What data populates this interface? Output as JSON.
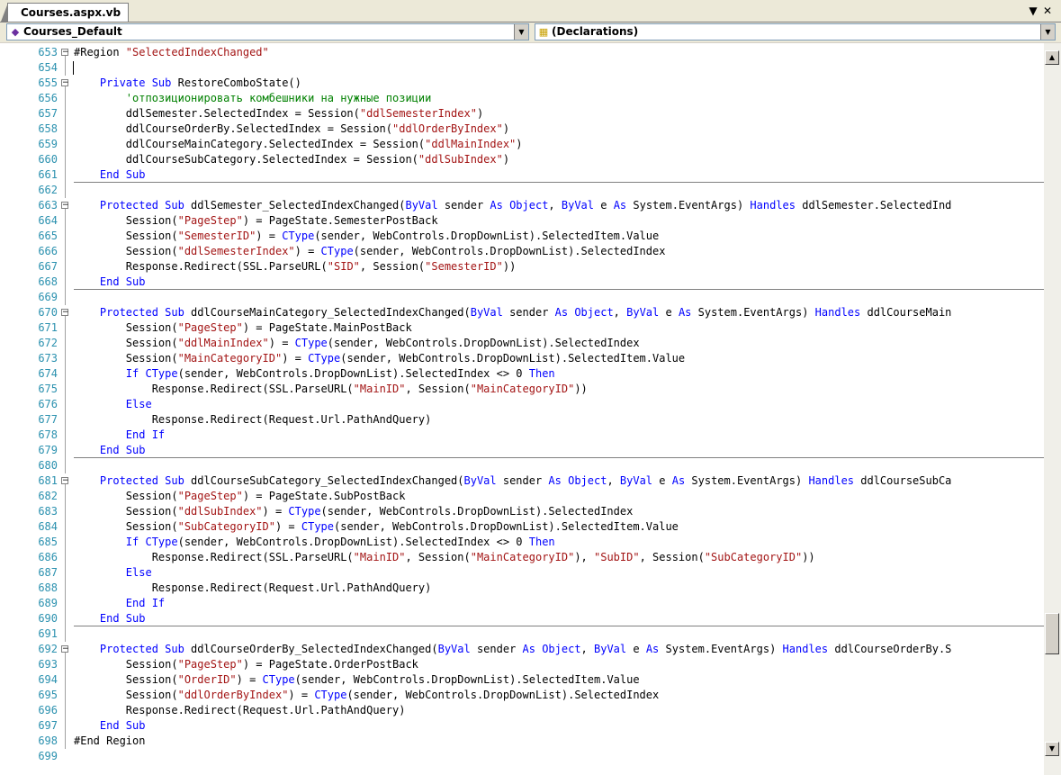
{
  "tab": {
    "title": "Courses.aspx.vb",
    "controls": {
      "dropdown": "▼",
      "close": "✕"
    }
  },
  "nav": {
    "class_combo": {
      "icon": "vb-class-icon",
      "value": "Courses_Default"
    },
    "member_combo": {
      "icon": "declarations-icon",
      "value": "(Declarations)"
    }
  },
  "code_lines": [
    {
      "n": "653",
      "fold": "box",
      "sep": false,
      "t": [
        [
          "",
          "#Region "
        ],
        [
          "str",
          "\"SelectedIndexChanged\""
        ]
      ]
    },
    {
      "n": "654",
      "fold": "line",
      "sep": false,
      "t": []
    },
    {
      "n": "655",
      "fold": "box",
      "sep": false,
      "t": [
        [
          "",
          "    "
        ],
        [
          "kw",
          "Private Sub"
        ],
        [
          "",
          " RestoreComboState()"
        ]
      ]
    },
    {
      "n": "656",
      "fold": "line",
      "sep": false,
      "t": [
        [
          "",
          "        "
        ],
        [
          "cm",
          "'отпозиционировать комбешники на нужные позиции"
        ]
      ]
    },
    {
      "n": "657",
      "fold": "line",
      "sep": false,
      "t": [
        [
          "",
          "        ddlSemester.SelectedIndex = Session("
        ],
        [
          "str",
          "\"ddlSemesterIndex\""
        ],
        [
          "",
          ")"
        ]
      ]
    },
    {
      "n": "658",
      "fold": "line",
      "sep": false,
      "t": [
        [
          "",
          "        ddlCourseOrderBy.SelectedIndex = Session("
        ],
        [
          "str",
          "\"ddlOrderByIndex\""
        ],
        [
          "",
          ")"
        ]
      ]
    },
    {
      "n": "659",
      "fold": "line",
      "sep": false,
      "t": [
        [
          "",
          "        ddlCourseMainCategory.SelectedIndex = Session("
        ],
        [
          "str",
          "\"ddlMainIndex\""
        ],
        [
          "",
          ")"
        ]
      ]
    },
    {
      "n": "660",
      "fold": "line",
      "sep": false,
      "t": [
        [
          "",
          "        ddlCourseSubCategory.SelectedIndex = Session("
        ],
        [
          "str",
          "\"ddlSubIndex\""
        ],
        [
          "",
          ")"
        ]
      ]
    },
    {
      "n": "661",
      "fold": "line",
      "sep": true,
      "t": [
        [
          "",
          "    "
        ],
        [
          "kw",
          "End Sub"
        ]
      ]
    },
    {
      "n": "662",
      "fold": "line",
      "sep": false,
      "t": []
    },
    {
      "n": "663",
      "fold": "box",
      "sep": false,
      "t": [
        [
          "",
          "    "
        ],
        [
          "kw",
          "Protected Sub"
        ],
        [
          "",
          " ddlSemester_SelectedIndexChanged("
        ],
        [
          "kw",
          "ByVal"
        ],
        [
          "",
          " sender "
        ],
        [
          "kw",
          "As Object"
        ],
        [
          "",
          ", "
        ],
        [
          "kw",
          "ByVal"
        ],
        [
          "",
          " e "
        ],
        [
          "kw",
          "As"
        ],
        [
          "",
          " System.EventArgs) "
        ],
        [
          "kw",
          "Handles"
        ],
        [
          "",
          " ddlSemester.SelectedInd"
        ]
      ]
    },
    {
      "n": "664",
      "fold": "line",
      "sep": false,
      "t": [
        [
          "",
          "        Session("
        ],
        [
          "str",
          "\"PageStep\""
        ],
        [
          "",
          ") = PageState.SemesterPostBack"
        ]
      ]
    },
    {
      "n": "665",
      "fold": "line",
      "sep": false,
      "t": [
        [
          "",
          "        Session("
        ],
        [
          "str",
          "\"SemesterID\""
        ],
        [
          "",
          ") = "
        ],
        [
          "kw",
          "CType"
        ],
        [
          "",
          "(sender, WebControls.DropDownList).SelectedItem.Value"
        ]
      ]
    },
    {
      "n": "666",
      "fold": "line",
      "sep": false,
      "t": [
        [
          "",
          "        Session("
        ],
        [
          "str",
          "\"ddlSemesterIndex\""
        ],
        [
          "",
          ") = "
        ],
        [
          "kw",
          "CType"
        ],
        [
          "",
          "(sender, WebControls.DropDownList).SelectedIndex"
        ]
      ]
    },
    {
      "n": "667",
      "fold": "line",
      "sep": false,
      "t": [
        [
          "",
          "        Response.Redirect(SSL.ParseURL("
        ],
        [
          "str",
          "\"SID\""
        ],
        [
          "",
          ", Session("
        ],
        [
          "str",
          "\"SemesterID\""
        ],
        [
          "",
          "))"
        ]
      ]
    },
    {
      "n": "668",
      "fold": "line",
      "sep": true,
      "t": [
        [
          "",
          "    "
        ],
        [
          "kw",
          "End Sub"
        ]
      ]
    },
    {
      "n": "669",
      "fold": "line",
      "sep": false,
      "t": []
    },
    {
      "n": "670",
      "fold": "box",
      "sep": false,
      "t": [
        [
          "",
          "    "
        ],
        [
          "kw",
          "Protected Sub"
        ],
        [
          "",
          " ddlCourseMainCategory_SelectedIndexChanged("
        ],
        [
          "kw",
          "ByVal"
        ],
        [
          "",
          " sender "
        ],
        [
          "kw",
          "As Object"
        ],
        [
          "",
          ", "
        ],
        [
          "kw",
          "ByVal"
        ],
        [
          "",
          " e "
        ],
        [
          "kw",
          "As"
        ],
        [
          "",
          " System.EventArgs) "
        ],
        [
          "kw",
          "Handles"
        ],
        [
          "",
          " ddlCourseMain"
        ]
      ]
    },
    {
      "n": "671",
      "fold": "line",
      "sep": false,
      "t": [
        [
          "",
          "        Session("
        ],
        [
          "str",
          "\"PageStep\""
        ],
        [
          "",
          ") = PageState.MainPostBack"
        ]
      ]
    },
    {
      "n": "672",
      "fold": "line",
      "sep": false,
      "t": [
        [
          "",
          "        Session("
        ],
        [
          "str",
          "\"ddlMainIndex\""
        ],
        [
          "",
          ") = "
        ],
        [
          "kw",
          "CType"
        ],
        [
          "",
          "(sender, WebControls.DropDownList).SelectedIndex"
        ]
      ]
    },
    {
      "n": "673",
      "fold": "line",
      "sep": false,
      "t": [
        [
          "",
          "        Session("
        ],
        [
          "str",
          "\"MainCategoryID\""
        ],
        [
          "",
          ") = "
        ],
        [
          "kw",
          "CType"
        ],
        [
          "",
          "(sender, WebControls.DropDownList).SelectedItem.Value"
        ]
      ]
    },
    {
      "n": "674",
      "fold": "line",
      "sep": false,
      "t": [
        [
          "",
          "        "
        ],
        [
          "kw",
          "If"
        ],
        [
          "",
          " "
        ],
        [
          "kw",
          "CType"
        ],
        [
          "",
          "(sender, WebControls.DropDownList).SelectedIndex <> 0 "
        ],
        [
          "kw",
          "Then"
        ]
      ]
    },
    {
      "n": "675",
      "fold": "line",
      "sep": false,
      "t": [
        [
          "",
          "            Response.Redirect(SSL.ParseURL("
        ],
        [
          "str",
          "\"MainID\""
        ],
        [
          "",
          ", Session("
        ],
        [
          "str",
          "\"MainCategoryID\""
        ],
        [
          "",
          "))"
        ]
      ]
    },
    {
      "n": "676",
      "fold": "line",
      "sep": false,
      "t": [
        [
          "",
          "        "
        ],
        [
          "kw",
          "Else"
        ]
      ]
    },
    {
      "n": "677",
      "fold": "line",
      "sep": false,
      "t": [
        [
          "",
          "            Response.Redirect(Request.Url.PathAndQuery)"
        ]
      ]
    },
    {
      "n": "678",
      "fold": "line",
      "sep": false,
      "t": [
        [
          "",
          "        "
        ],
        [
          "kw",
          "End If"
        ]
      ]
    },
    {
      "n": "679",
      "fold": "line",
      "sep": true,
      "t": [
        [
          "",
          "    "
        ],
        [
          "kw",
          "End Sub"
        ]
      ]
    },
    {
      "n": "680",
      "fold": "line",
      "sep": false,
      "t": []
    },
    {
      "n": "681",
      "fold": "box",
      "sep": false,
      "t": [
        [
          "",
          "    "
        ],
        [
          "kw",
          "Protected Sub"
        ],
        [
          "",
          " ddlCourseSubCategory_SelectedIndexChanged("
        ],
        [
          "kw",
          "ByVal"
        ],
        [
          "",
          " sender "
        ],
        [
          "kw",
          "As Object"
        ],
        [
          "",
          ", "
        ],
        [
          "kw",
          "ByVal"
        ],
        [
          "",
          " e "
        ],
        [
          "kw",
          "As"
        ],
        [
          "",
          " System.EventArgs) "
        ],
        [
          "kw",
          "Handles"
        ],
        [
          "",
          " ddlCourseSubCa"
        ]
      ]
    },
    {
      "n": "682",
      "fold": "line",
      "sep": false,
      "t": [
        [
          "",
          "        Session("
        ],
        [
          "str",
          "\"PageStep\""
        ],
        [
          "",
          ") = PageState.SubPostBack"
        ]
      ]
    },
    {
      "n": "683",
      "fold": "line",
      "sep": false,
      "t": [
        [
          "",
          "        Session("
        ],
        [
          "str",
          "\"ddlSubIndex\""
        ],
        [
          "",
          ") = "
        ],
        [
          "kw",
          "CType"
        ],
        [
          "",
          "(sender, WebControls.DropDownList).SelectedIndex"
        ]
      ]
    },
    {
      "n": "684",
      "fold": "line",
      "sep": false,
      "t": [
        [
          "",
          "        Session("
        ],
        [
          "str",
          "\"SubCategoryID\""
        ],
        [
          "",
          ") = "
        ],
        [
          "kw",
          "CType"
        ],
        [
          "",
          "(sender, WebControls.DropDownList).SelectedItem.Value"
        ]
      ]
    },
    {
      "n": "685",
      "fold": "line",
      "sep": false,
      "t": [
        [
          "",
          "        "
        ],
        [
          "kw",
          "If"
        ],
        [
          "",
          " "
        ],
        [
          "kw",
          "CType"
        ],
        [
          "",
          "(sender, WebControls.DropDownList).SelectedIndex <> 0 "
        ],
        [
          "kw",
          "Then"
        ]
      ]
    },
    {
      "n": "686",
      "fold": "line",
      "sep": false,
      "t": [
        [
          "",
          "            Response.Redirect(SSL.ParseURL("
        ],
        [
          "str",
          "\"MainID\""
        ],
        [
          "",
          ", Session("
        ],
        [
          "str",
          "\"MainCategoryID\""
        ],
        [
          "",
          "), "
        ],
        [
          "str",
          "\"SubID\""
        ],
        [
          "",
          ", Session("
        ],
        [
          "str",
          "\"SubCategoryID\""
        ],
        [
          "",
          "))"
        ]
      ]
    },
    {
      "n": "687",
      "fold": "line",
      "sep": false,
      "t": [
        [
          "",
          "        "
        ],
        [
          "kw",
          "Else"
        ]
      ]
    },
    {
      "n": "688",
      "fold": "line",
      "sep": false,
      "t": [
        [
          "",
          "            Response.Redirect(Request.Url.PathAndQuery)"
        ]
      ]
    },
    {
      "n": "689",
      "fold": "line",
      "sep": false,
      "t": [
        [
          "",
          "        "
        ],
        [
          "kw",
          "End If"
        ]
      ]
    },
    {
      "n": "690",
      "fold": "line",
      "sep": true,
      "t": [
        [
          "",
          "    "
        ],
        [
          "kw",
          "End Sub"
        ]
      ]
    },
    {
      "n": "691",
      "fold": "line",
      "sep": false,
      "t": []
    },
    {
      "n": "692",
      "fold": "box",
      "sep": false,
      "t": [
        [
          "",
          "    "
        ],
        [
          "kw",
          "Protected Sub"
        ],
        [
          "",
          " ddlCourseOrderBy_SelectedIndexChanged("
        ],
        [
          "kw",
          "ByVal"
        ],
        [
          "",
          " sender "
        ],
        [
          "kw",
          "As Object"
        ],
        [
          "",
          ", "
        ],
        [
          "kw",
          "ByVal"
        ],
        [
          "",
          " e "
        ],
        [
          "kw",
          "As"
        ],
        [
          "",
          " System.EventArgs) "
        ],
        [
          "kw",
          "Handles"
        ],
        [
          "",
          " ddlCourseOrderBy.S"
        ]
      ]
    },
    {
      "n": "693",
      "fold": "line",
      "sep": false,
      "t": [
        [
          "",
          "        Session("
        ],
        [
          "str",
          "\"PageStep\""
        ],
        [
          "",
          ") = PageState.OrderPostBack"
        ]
      ]
    },
    {
      "n": "694",
      "fold": "line",
      "sep": false,
      "t": [
        [
          "",
          "        Session("
        ],
        [
          "str",
          "\"OrderID\""
        ],
        [
          "",
          ") = "
        ],
        [
          "kw",
          "CType"
        ],
        [
          "",
          "(sender, WebControls.DropDownList).SelectedItem.Value"
        ]
      ]
    },
    {
      "n": "695",
      "fold": "line",
      "sep": false,
      "t": [
        [
          "",
          "        Session("
        ],
        [
          "str",
          "\"ddlOrderByIndex\""
        ],
        [
          "",
          ") = "
        ],
        [
          "kw",
          "CType"
        ],
        [
          "",
          "(sender, WebControls.DropDownList).SelectedIndex"
        ]
      ]
    },
    {
      "n": "696",
      "fold": "line",
      "sep": false,
      "t": [
        [
          "",
          "        Response.Redirect(Request.Url.PathAndQuery)"
        ]
      ]
    },
    {
      "n": "697",
      "fold": "line",
      "sep": false,
      "t": [
        [
          "",
          "    "
        ],
        [
          "kw",
          "End Sub"
        ]
      ]
    },
    {
      "n": "698",
      "fold": "line",
      "sep": false,
      "t": [
        [
          "",
          "#End Region"
        ]
      ]
    },
    {
      "n": "699",
      "fold": "none",
      "sep": false,
      "t": []
    }
  ],
  "scrollbar": {
    "up": "▲",
    "down": "▼",
    "position": 0.87
  },
  "colors": {
    "keyword": "#0000ff",
    "string": "#a31515",
    "comment": "#008000",
    "line_number": "#2b91af"
  }
}
